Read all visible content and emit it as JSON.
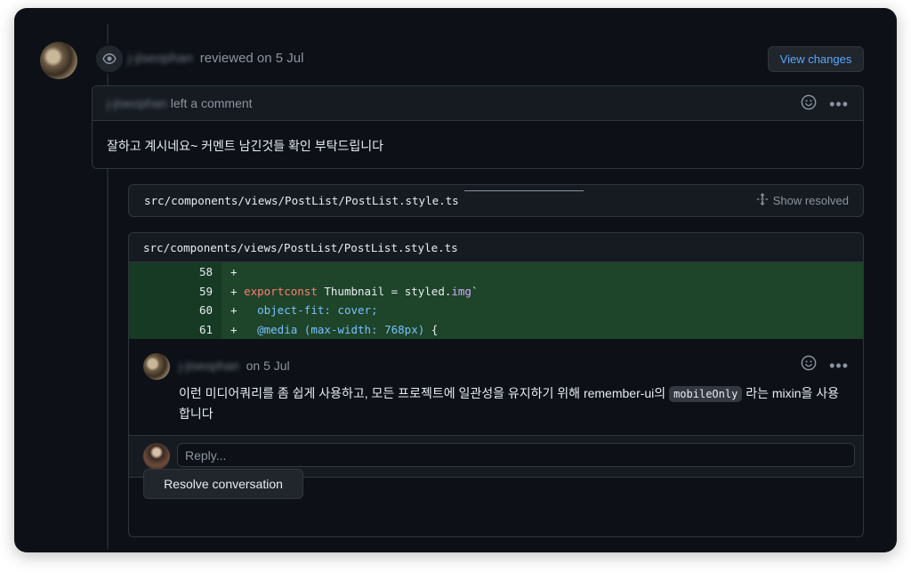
{
  "review": {
    "author": "j-jiseophan",
    "action": "reviewed on 5 Jul",
    "view_changes_label": "View changes"
  },
  "top_comment": {
    "author": "j-jiseophan",
    "action": "left a comment",
    "body": "잘하고 계시네요~ 커멘트 남긴것들 확인 부탁드립니다"
  },
  "file_bar": {
    "path": "src/components/views/PostList/PostList.style.ts",
    "show_resolved_label": "Show resolved"
  },
  "thread": {
    "path": "src/components/views/PostList/PostList.style.ts",
    "diff_lines": [
      {
        "num": "58",
        "text": "+"
      },
      {
        "num": "59",
        "text": "+ export const Thumbnail = styled.img`"
      },
      {
        "num": "60",
        "text": "+   object-fit: cover;"
      },
      {
        "num": "61",
        "text": "+   @media (max-width: 768px) {"
      }
    ],
    "comment": {
      "author": "j-jiseophan",
      "date": "on 5 Jul",
      "body_before": "이런 미디어쿼리를 좀 쉽게 사용하고, 모든 프로젝트에 일관성을 유지하기 위해 remember-ui의 ",
      "code": "mobileOnly",
      "body_after": " 라는 mixin을 사용합니다"
    },
    "reply_placeholder": "Reply...",
    "resolve_label": "Resolve conversation"
  },
  "icons": {
    "eye": "eye-icon",
    "smiley": "smiley-icon",
    "kebab": "kebab-horizontal-icon",
    "unfold": "unfold-icon"
  },
  "colors": {
    "background": "#0d1117",
    "accent_link": "#58a6ff",
    "diff_added": "#1e4429"
  }
}
